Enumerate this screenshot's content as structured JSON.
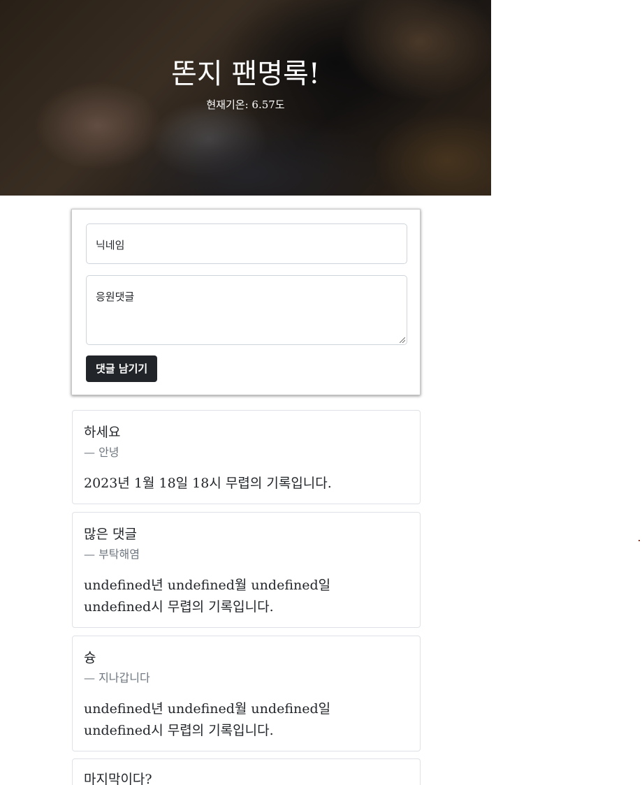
{
  "hero": {
    "title": "똔지 팬명록!",
    "temperature": "현재기온: 6.57도"
  },
  "form": {
    "nickname_placeholder": "닉네임",
    "comment_placeholder": "응원댓글",
    "submit_label": "댓글 남기기"
  },
  "comments": [
    {
      "text": "하세요",
      "author": "— 안녕",
      "date": "2023년 1월 18일 18시 무렵의 기록입니다."
    },
    {
      "text": "많은 댓글",
      "author": "— 부탁해염",
      "date": "undefined년 undefined월 undefined일 undefined시 무렵의 기록입니다."
    },
    {
      "text": "슝",
      "author": "— 지나갑니다",
      "date": "undefined년 undefined월 undefined일 undefined시 무렵의 기록입니다."
    },
    {
      "text": "마지막이다?",
      "author": "",
      "date": ""
    }
  ]
}
